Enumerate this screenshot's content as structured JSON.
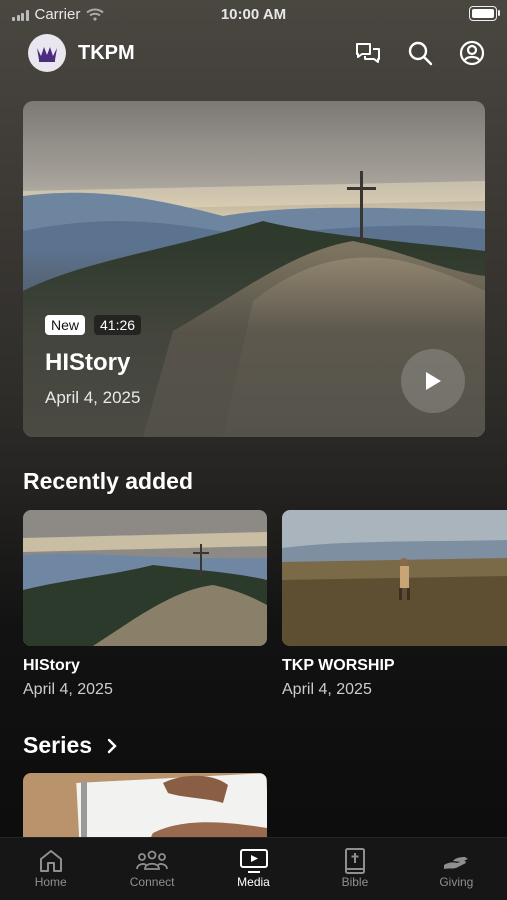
{
  "status_bar": {
    "carrier": "Carrier",
    "time": "10:00 AM"
  },
  "header": {
    "title": "TKPM"
  },
  "hero": {
    "badge_new": "New",
    "duration": "41:26",
    "title": "HIStory",
    "date": "April 4, 2025"
  },
  "recently_added": {
    "title": "Recently added",
    "items": [
      {
        "title": "HIStory",
        "date": "April 4, 2025"
      },
      {
        "title": "TKP WORSHIP",
        "date": "April 4, 2025"
      }
    ]
  },
  "series": {
    "title": "Series"
  },
  "tabs": [
    {
      "label": "Home",
      "icon": "home-icon"
    },
    {
      "label": "Connect",
      "icon": "people-icon"
    },
    {
      "label": "Media",
      "icon": "tv-icon",
      "active": true
    },
    {
      "label": "Bible",
      "icon": "bible-icon"
    },
    {
      "label": "Giving",
      "icon": "giving-icon"
    }
  ],
  "colors": {
    "logo_purple": "#4b2d7f",
    "tab_active": "#ffffff",
    "tab_inactive": "#8f8f8f"
  }
}
